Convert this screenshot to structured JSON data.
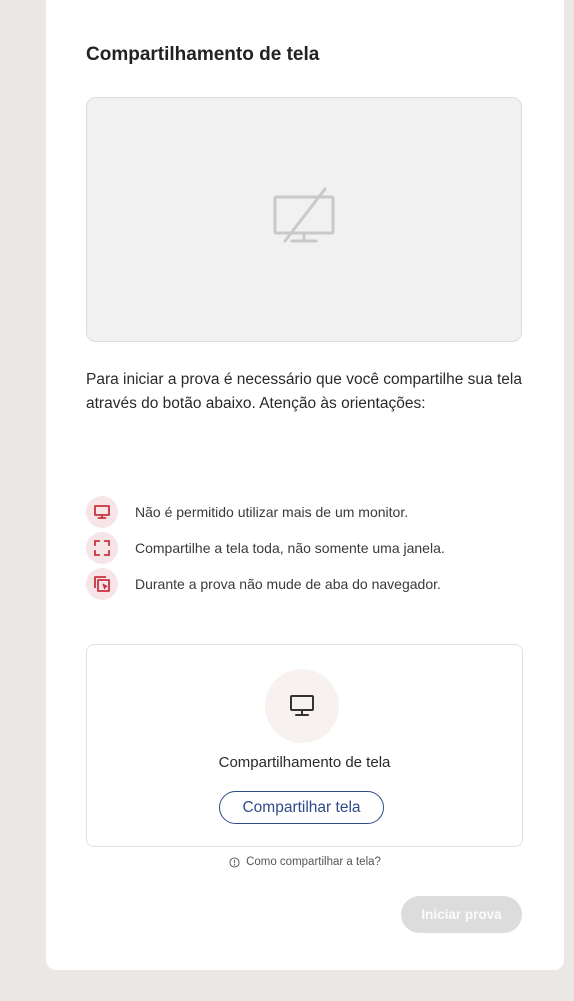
{
  "title": "Compartilhamento de tela",
  "preview": {
    "icon": "screen-off-icon"
  },
  "intro": "Para iniciar a prova é necessário que você compartilhe sua tela através do botão abaixo. Atenção às orientações:",
  "rules": [
    {
      "icon": "monitor-icon",
      "text": "Não é permitido utilizar mais de um monitor."
    },
    {
      "icon": "fullscreen-icon",
      "text": "Compartilhe a tela toda, não somente uma janela."
    },
    {
      "icon": "tab-icon",
      "text": "Durante a prova não mude de aba do navegador."
    }
  ],
  "share": {
    "icon": "monitor-icon",
    "label": "Compartilhamento de tela",
    "button": "Compartilhar tela"
  },
  "help": {
    "icon": "info-icon",
    "text": "Como compartilhar a tela?"
  },
  "start_button": "Iniciar prova",
  "colors": {
    "accent": "#2f4b8a",
    "rule_icon": "#c8323f",
    "rule_icon_bg": "#f7e4e6",
    "disabled": "#dcdcdc",
    "background": "#ebe7e4"
  }
}
